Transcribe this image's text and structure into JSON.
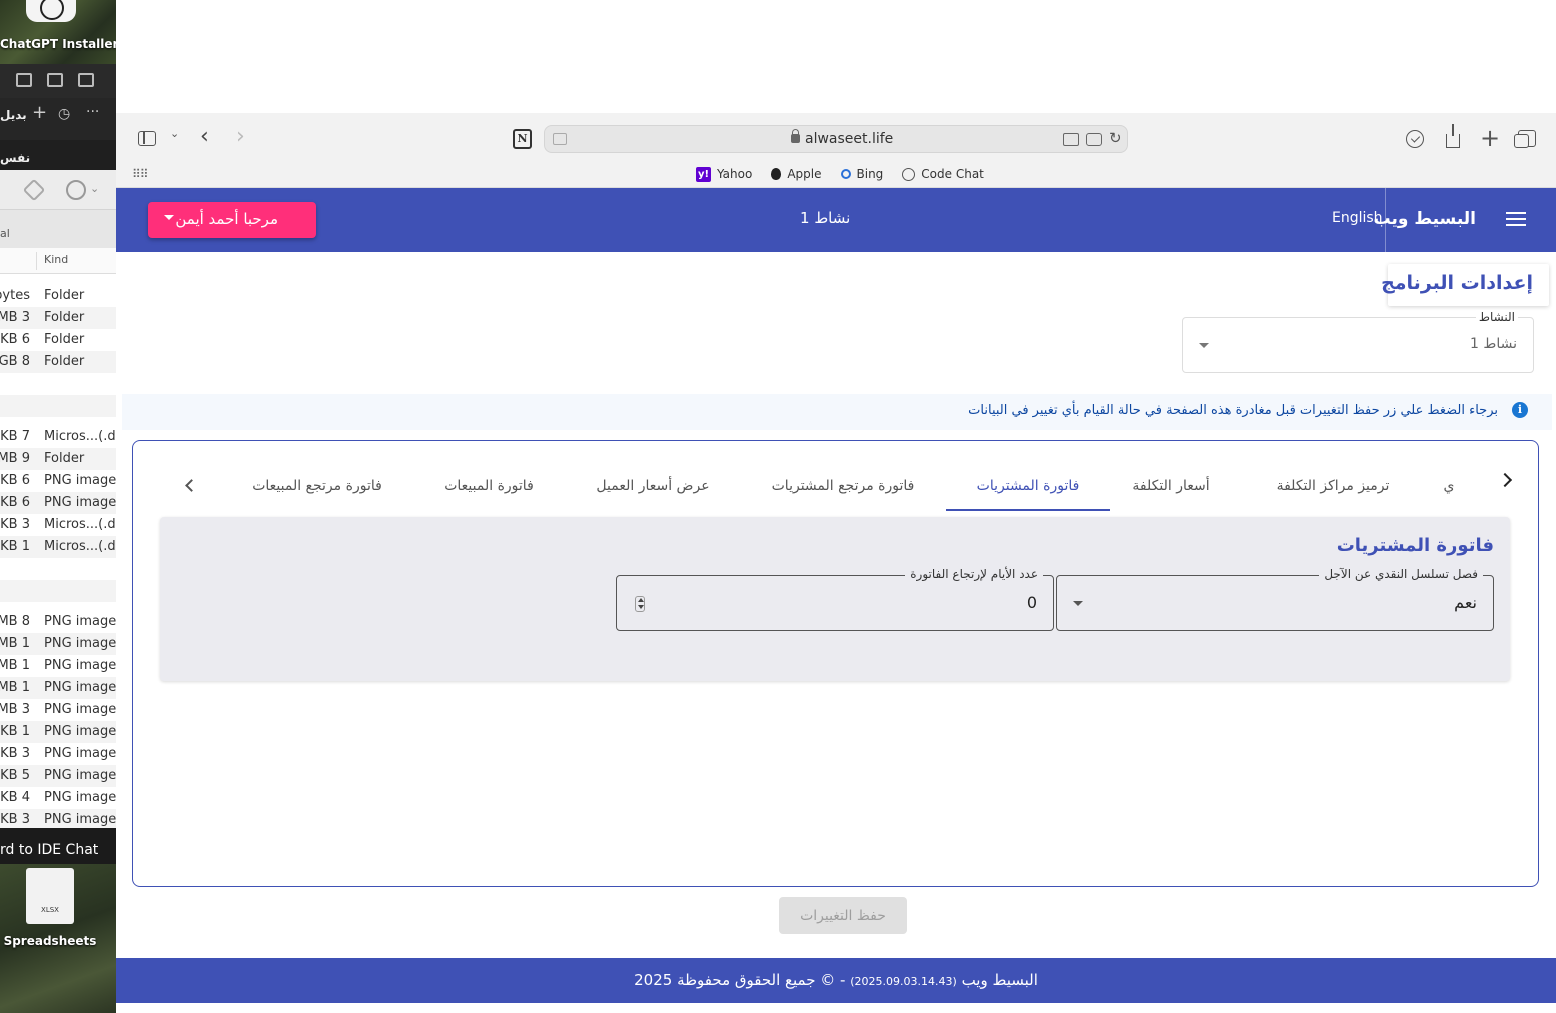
{
  "desktop": {
    "top_app_label": "ChatGPT Installer",
    "bottom_file_label": "Spreadsheets",
    "bottom_file_icon_text": "XLSX"
  },
  "finder": {
    "toolbar_text": "بديل",
    "sub_text": "نفس",
    "section_label": "al",
    "column_kind": "Kind",
    "rows": [
      {
        "size": "bytes",
        "kind": "Folder"
      },
      {
        "size": "3 MB",
        "kind": "Folder"
      },
      {
        "size": "6 KB",
        "kind": "Folder"
      },
      {
        "size": "8 GB",
        "kind": "Folder"
      },
      {
        "size": "",
        "kind": ""
      },
      {
        "size": "",
        "kind": ""
      },
      {
        "size": "7 KB",
        "kind": "Micros...(.do"
      },
      {
        "size": "9 MB",
        "kind": "Folder"
      },
      {
        "size": "6 KB",
        "kind": "PNG image"
      },
      {
        "size": "6 KB",
        "kind": "PNG image"
      },
      {
        "size": "3 KB",
        "kind": "Micros...(.do"
      },
      {
        "size": "1 KB",
        "kind": "Micros...(.do"
      },
      {
        "size": "",
        "kind": ""
      },
      {
        "size": "",
        "kind": ""
      },
      {
        "size": "8 MB",
        "kind": "PNG image"
      },
      {
        "size": "1 MB",
        "kind": "PNG image"
      },
      {
        "size": "1 MB",
        "kind": "PNG image"
      },
      {
        "size": "1 MB",
        "kind": "PNG image"
      },
      {
        "size": "3 MB",
        "kind": "PNG image"
      },
      {
        "size": "1 KB",
        "kind": "PNG image"
      },
      {
        "size": "3 KB",
        "kind": "PNG image"
      },
      {
        "size": "5 KB",
        "kind": "PNG image"
      },
      {
        "size": "4 KB",
        "kind": "PNG image"
      },
      {
        "size": "3 KB",
        "kind": "PNG image"
      }
    ],
    "status_text": "rd to IDE Chat"
  },
  "browser": {
    "url": "alwaseet.life",
    "bookmarks": [
      {
        "label": "Yahoo",
        "icon": "yahoo-icon"
      },
      {
        "label": "Apple",
        "icon": "apple-icon"
      },
      {
        "label": "Bing",
        "icon": "bing-icon"
      },
      {
        "label": "Code Chat",
        "icon": "globe-icon"
      }
    ]
  },
  "header": {
    "brand": "البسيط ويب",
    "language_link": "English",
    "activity": "نشاط 1",
    "user_button": "مرحبا أحمد أيمن"
  },
  "page": {
    "title": "إعدادات البرنامج",
    "activity_select": {
      "label": "النشاط",
      "value": "نشاط 1"
    },
    "info_message": "برجاء الضغط علي زر حفظ التغييرات قبل مغادرة هذه الصفحة في حالة القيام بأي تغيير في البيانات",
    "tabs": [
      "ي",
      "ترميز مراكز التكلفة",
      "أسعار التكلفة",
      "فاتورة المشتريات",
      "فاتورة مرتجع المشتريات",
      "عرض أسعار العميل",
      "فاتورة المبيعات",
      "فاتورة مرتجع المبيعات"
    ],
    "active_tab": "فاتورة المشتريات",
    "panel": {
      "title": "فاتورة المشتريات",
      "cash_sequence_field": {
        "label": "فصل تسلسل النقدي عن الآجل",
        "value": "نعم"
      },
      "return_days_field": {
        "label": "عدد الأيام لإرتجاع الفاتورة",
        "value": "0"
      }
    },
    "save_button": "حفظ التغييرات"
  },
  "footer": {
    "text": "البسيط ويب",
    "version": "(2025.09.03.14.43)",
    "rights": "- © جميع الحقوق محفوظة 2025"
  },
  "colors": {
    "primary": "#3f51b5",
    "accent": "#ff2f7a",
    "info": "#1976d2"
  }
}
